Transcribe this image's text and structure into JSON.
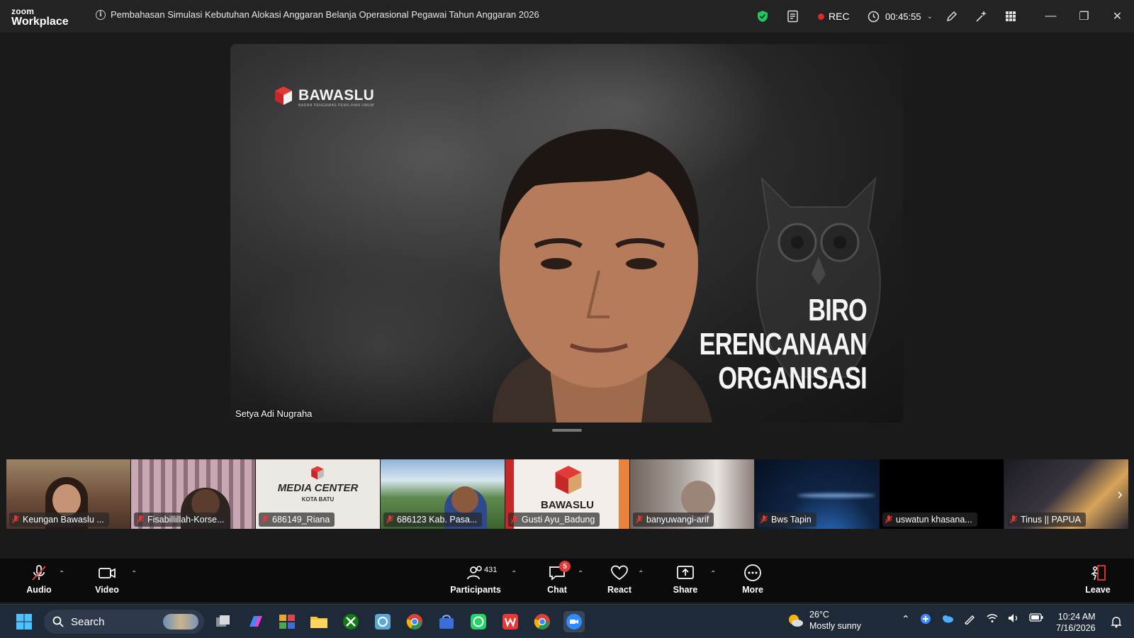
{
  "app": {
    "logo_line1": "zoom",
    "logo_line2": "Workplace",
    "meeting_title": "Pembahasan Simulasi Kebutuhan Alokasi Anggaran Belanja Operasional Pegawai Tahun Anggaran 2026",
    "rec_label": "REC",
    "timer": "00:45:55"
  },
  "main_video": {
    "speaker_name": "Setya Adi Nugraha",
    "brand_text": "BAWASLU",
    "brand_sub": "BADAN PENGAWAS PEMILIHAN UMUM",
    "background_lines": [
      "BIRO",
      "ERENCANAAN",
      "ORGANISASI"
    ]
  },
  "thumbnails": [
    {
      "name": "Keungan Bawaslu ...",
      "bg": "#7a5a44"
    },
    {
      "name": "Fisabillillah-Korse...",
      "bg": "#8b6f77"
    },
    {
      "name": "686149_Riana",
      "bg": "#e8e4df",
      "caption": "MEDIA CENTER",
      "caption_sub": "KOTA BATU"
    },
    {
      "name": "686123 Kab. Pasa...",
      "bg": "#4d7a45"
    },
    {
      "name": "Gusti Ayu_Badung",
      "bg": "#f1e9e3",
      "caption": "BAWASLU"
    },
    {
      "name": "banyuwangi-arif",
      "bg": "#9e938a"
    },
    {
      "name": "Bws Tapin",
      "bg": "#0f2546"
    },
    {
      "name": "uswatun khasana...",
      "bg": "#000000"
    },
    {
      "name": "Tinus || PAPUA",
      "bg": "#2c2a30"
    }
  ],
  "toolbar": {
    "audio": "Audio",
    "video": "Video",
    "participants": "Participants",
    "participants_count": "431",
    "chat": "Chat",
    "chat_badge": "5",
    "react": "React",
    "share": "Share",
    "more": "More",
    "leave": "Leave"
  },
  "taskbar": {
    "search_placeholder": "Search",
    "weather_temp": "26°C",
    "weather_desc": "Mostly sunny",
    "time": "10:24 AM",
    "date": "7/16/2026"
  },
  "colors": {
    "rec": "#e02828",
    "shield": "#22c55e",
    "chat_badge": "#e53935",
    "leave_icon": "#e53935"
  }
}
